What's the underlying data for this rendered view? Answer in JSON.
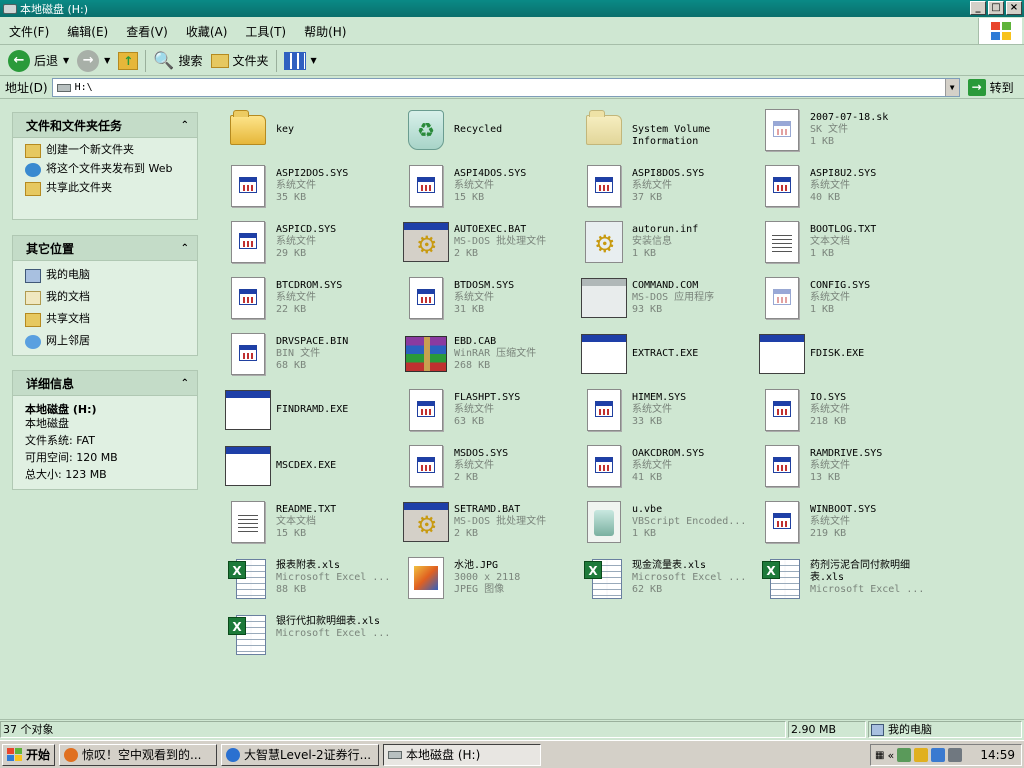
{
  "window": {
    "title": "本地磁盘 (H:)"
  },
  "menu": [
    "文件(F)",
    "编辑(E)",
    "查看(V)",
    "收藏(A)",
    "工具(T)",
    "帮助(H)"
  ],
  "toolbar": {
    "back": "后退",
    "search": "搜索",
    "folders": "文件夹"
  },
  "address": {
    "label": "地址(D)",
    "value": "H:\\",
    "go": "转到"
  },
  "tasks": {
    "title": "文件和文件夹任务",
    "links": [
      "创建一个新文件夹",
      "将这个文件夹发布到 Web",
      "共享此文件夹"
    ]
  },
  "places": {
    "title": "其它位置",
    "links": [
      "我的电脑",
      "我的文档",
      "共享文档",
      "网上邻居"
    ]
  },
  "details": {
    "title": "详细信息",
    "name": "本地磁盘 (H:)",
    "type": "本地磁盘",
    "fs": "文件系统: FAT",
    "free": "可用空间: 120 MB",
    "total": "总大小: 123 MB"
  },
  "files": [
    {
      "name": "key",
      "icon": "folder"
    },
    {
      "name": "Recycled",
      "icon": "recycle-bin"
    },
    {
      "name": "System Volume Information",
      "icon": "folder-system"
    },
    {
      "name": "2007-07-18.sk",
      "type": "SK 文件",
      "size": "1 KB",
      "icon": "sys-gray"
    },
    {
      "name": "ASPI2DOS.SYS",
      "type": "系统文件",
      "size": "35 KB",
      "icon": "sys"
    },
    {
      "name": "ASPI4DOS.SYS",
      "type": "系统文件",
      "size": "15 KB",
      "icon": "sys"
    },
    {
      "name": "ASPI8DOS.SYS",
      "type": "系统文件",
      "size": "37 KB",
      "icon": "sys"
    },
    {
      "name": "ASPI8U2.SYS",
      "type": "系统文件",
      "size": "40 KB",
      "icon": "sys"
    },
    {
      "name": "ASPICD.SYS",
      "type": "系统文件",
      "size": "29 KB",
      "icon": "sys"
    },
    {
      "name": "AUTOEXEC.BAT",
      "type": "MS-DOS 批处理文件",
      "size": "2 KB",
      "icon": "bat"
    },
    {
      "name": "autorun.inf",
      "type": "安装信息",
      "size": "1 KB",
      "icon": "inf"
    },
    {
      "name": "BOOTLOG.TXT",
      "type": "文本文档",
      "size": "1 KB",
      "icon": "txt"
    },
    {
      "name": "BTCDROM.SYS",
      "type": "系统文件",
      "size": "22 KB",
      "icon": "sys"
    },
    {
      "name": "BTDOSM.SYS",
      "type": "系统文件",
      "size": "31 KB",
      "icon": "sys"
    },
    {
      "name": "COMMAND.COM",
      "type": "MS-DOS 应用程序",
      "size": "93 KB",
      "icon": "com"
    },
    {
      "name": "CONFIG.SYS",
      "type": "系统文件",
      "size": "1 KB",
      "icon": "sys-gray"
    },
    {
      "name": "DRVSPACE.BIN",
      "type": "BIN 文件",
      "size": "68 KB",
      "icon": "sys"
    },
    {
      "name": "EBD.CAB",
      "type": "WinRAR 压缩文件",
      "size": "268 KB",
      "icon": "rar"
    },
    {
      "name": "EXTRACT.EXE",
      "icon": "exe"
    },
    {
      "name": "FDISK.EXE",
      "icon": "exe"
    },
    {
      "name": "FINDRAMD.EXE",
      "icon": "exe"
    },
    {
      "name": "FLASHPT.SYS",
      "type": "系统文件",
      "size": "63 KB",
      "icon": "sys"
    },
    {
      "name": "HIMEM.SYS",
      "type": "系统文件",
      "size": "33 KB",
      "icon": "sys"
    },
    {
      "name": "IO.SYS",
      "type": "系统文件",
      "size": "218 KB",
      "icon": "sys"
    },
    {
      "name": "MSCDEX.EXE",
      "icon": "exe"
    },
    {
      "name": "MSDOS.SYS",
      "type": "系统文件",
      "size": "2 KB",
      "icon": "sys"
    },
    {
      "name": "OAKCDROM.SYS",
      "type": "系统文件",
      "size": "41 KB",
      "icon": "sys"
    },
    {
      "name": "RAMDRIVE.SYS",
      "type": "系统文件",
      "size": "13 KB",
      "icon": "sys"
    },
    {
      "name": "README.TXT",
      "type": "文本文档",
      "size": "15 KB",
      "icon": "txt"
    },
    {
      "name": "SETRAMD.BAT",
      "type": "MS-DOS 批处理文件",
      "size": "2 KB",
      "icon": "bat"
    },
    {
      "name": "u.vbe",
      "type": "VBScript Encoded...",
      "size": "1 KB",
      "icon": "vbe"
    },
    {
      "name": "WINBOOT.SYS",
      "type": "系统文件",
      "size": "219 KB",
      "icon": "sys"
    },
    {
      "name": "报表附表.xls",
      "type": "Microsoft Excel ...",
      "size": "88 KB",
      "icon": "xls"
    },
    {
      "name": "水池.JPG",
      "type": "3000 x 2118",
      "size": "JPEG 图像",
      "icon": "jpg"
    },
    {
      "name": "现金流量表.xls",
      "type": "Microsoft Excel ...",
      "size": "62 KB",
      "icon": "xls"
    },
    {
      "name": "药剂污泥合同付款明细表.xls",
      "type": "Microsoft Excel ...",
      "icon": "xls"
    },
    {
      "name": "银行代扣款明细表.xls",
      "type": "Microsoft Excel ...",
      "icon": "xls"
    }
  ],
  "status": {
    "count": "37 个对象",
    "size": "2.90 MB",
    "location": "我的电脑"
  },
  "taskbar": {
    "start": "开始",
    "tasks": [
      "惊叹！空中观看到的...",
      "大智慧Level-2证券行...",
      "本地磁盘 (H:)"
    ],
    "clock": "14:59"
  }
}
